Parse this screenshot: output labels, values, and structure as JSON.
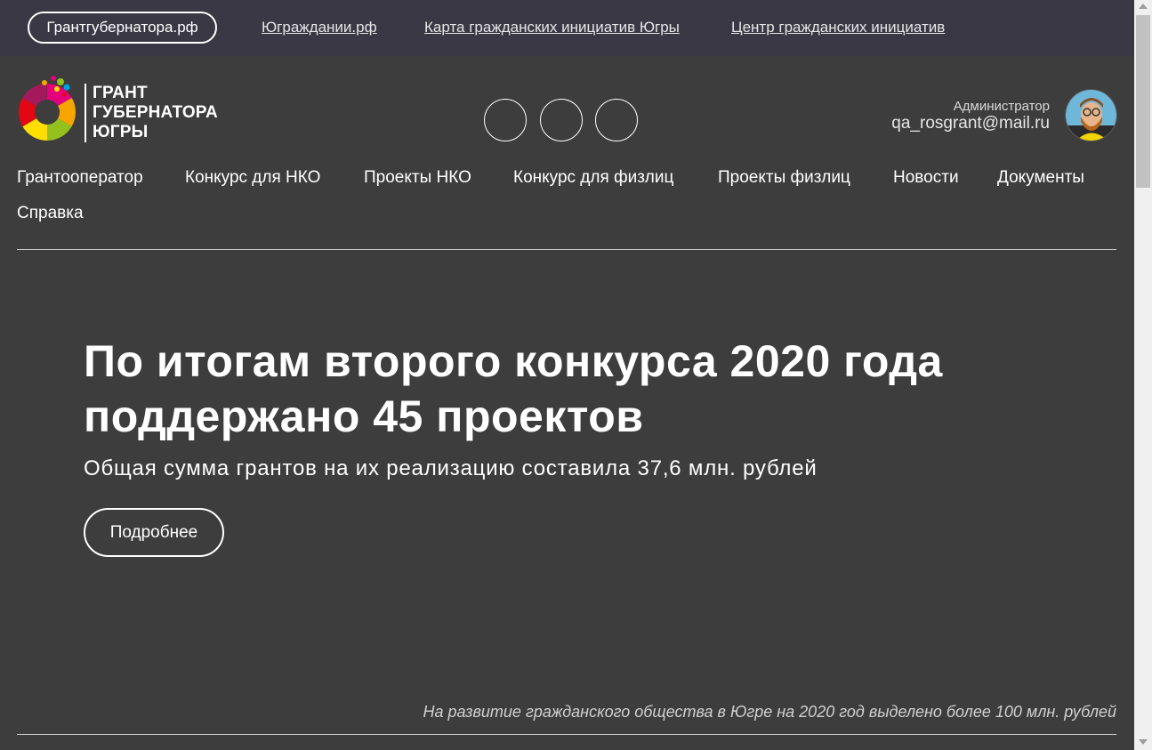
{
  "topbar": {
    "primary_link": "Грантгубернатора.рф",
    "links": [
      "Юграждании.рф",
      "Карта гражданских инициатив Югры",
      "Центр гражданских инициатив"
    ]
  },
  "logo": {
    "lines": [
      "ГРАНТ",
      "ГУБЕРНАТОРА",
      "ЮГРЫ"
    ]
  },
  "social": [
    "social-icon-1",
    "social-icon-2",
    "social-icon-3"
  ],
  "user": {
    "role": "Администратор",
    "email": "qa_rosgrant@mail.ru"
  },
  "nav": {
    "items": [
      "Грантооператор",
      "Конкурс для НКО",
      "Проекты НКО",
      "Конкурс для физлиц",
      "Проекты физлиц",
      "Новости",
      "Документы",
      "Справка"
    ]
  },
  "hero": {
    "title": "По итогам второго конкурса 2020 года поддержано 45 проектов",
    "subtitle": "Общая сумма грантов на их реализацию составила 37,6 млн. рублей",
    "button": "Подробнее"
  },
  "footer_note": "На развитие гражданского общества в Югре на 2020 год выделено более 100 млн. рублей",
  "colors": {
    "background": "#3d3d3d",
    "topbar": "#3a3845",
    "text": "#ffffff"
  }
}
